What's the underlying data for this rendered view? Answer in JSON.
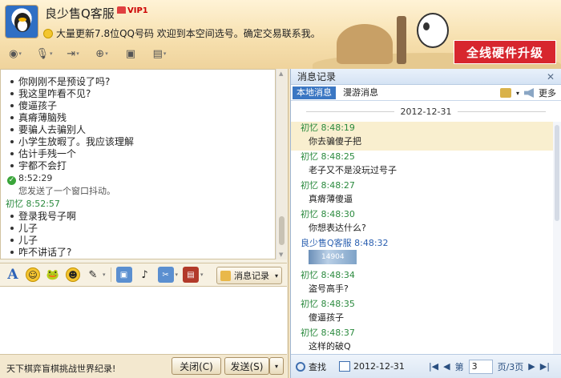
{
  "header": {
    "contact_name": "良少售Q客服",
    "vip_label": "VIP1",
    "signature": "大量更新7.8位QQ号码  欢迎到本空间选号。确定交易联系我。",
    "upgrade_banner": "全线硬件升级",
    "toolbar": [
      "video-call-icon",
      "mic-icon",
      "transfer-file-icon",
      "invite-icon",
      "remote-desktop-icon",
      "apps-icon"
    ]
  },
  "chat": {
    "messages_top": [
      "你刚刚不是预设了吗?",
      "我这里咋看不见?",
      "傻逼孩子",
      "真瘠薄脑残",
      "要骗人去骗别人",
      "小学生放暇了。我应该理解",
      "估计手残一个",
      "宇都不会打"
    ],
    "system_time": "8:52:29",
    "system_text": "您发送了一个窗口抖动。",
    "sender_line": "初忆   8:52:57",
    "messages_bottom": [
      "登录我号子啊",
      "儿子",
      "儿子",
      "咋不讲话了?"
    ]
  },
  "format_bar": {
    "history_button": "消息记录"
  },
  "footer": {
    "ad_text": "天下棋弈盲棋挑战世界纪录!",
    "close_button": "关闭(C)",
    "send_button": "发送(S)"
  },
  "history": {
    "title": "消息记录",
    "tabs": [
      "本地消息",
      "漫游消息"
    ],
    "more": "更多",
    "date": "2012-12-31",
    "entries": [
      {
        "meta": "初忆  8:48:19",
        "body": "你去骗傻子把",
        "highlight": true,
        "kind": "text",
        "color": "green"
      },
      {
        "meta": "初忆  8:48:25",
        "body": "老子又不是没玩过号子",
        "highlight": false,
        "kind": "text",
        "color": "green"
      },
      {
        "meta": "初忆  8:48:27",
        "body": "真瘠薄傻逼",
        "highlight": false,
        "kind": "text",
        "color": "green"
      },
      {
        "meta": "初忆  8:48:30",
        "body": "你想表达什么?",
        "highlight": false,
        "kind": "text",
        "color": "green"
      },
      {
        "meta": "良少售Q客服  8:48:32",
        "body": "14904",
        "highlight": false,
        "kind": "image",
        "color": "blue"
      },
      {
        "meta": "初忆  8:48:34",
        "body": "盗号高手?",
        "highlight": false,
        "kind": "text",
        "color": "green"
      },
      {
        "meta": "初忆  8:48:35",
        "body": "傻逼孩子",
        "highlight": false,
        "kind": "text",
        "color": "green"
      },
      {
        "meta": "初忆  8:48:37",
        "body": "这样的破Q",
        "highlight": false,
        "kind": "text",
        "color": "green"
      }
    ],
    "footer": {
      "search": "查找",
      "date": "2012-12-31",
      "page_prefix": "第",
      "page_value": "3",
      "page_suffix": "页/3页"
    }
  }
}
